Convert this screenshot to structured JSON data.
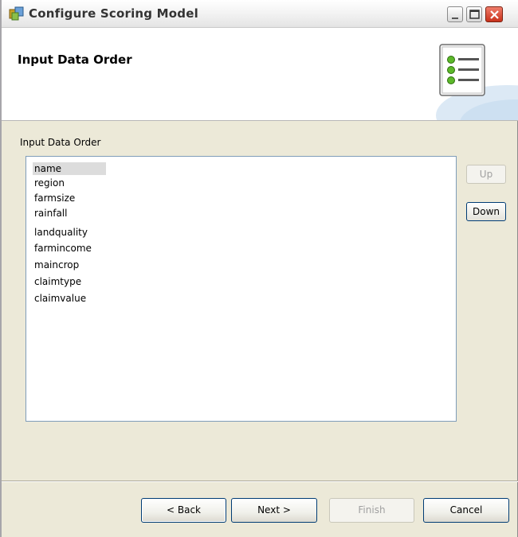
{
  "window": {
    "title": "Configure Scoring Model"
  },
  "banner": {
    "title": "Input Data Order",
    "icon": "list-icon"
  },
  "main": {
    "section_label": "Input Data Order",
    "fields": [
      "name",
      "region",
      "farmsize",
      "rainfall",
      "landquality",
      "farmincome",
      "maincrop",
      "claimtype",
      "claimvalue"
    ],
    "selected_field": "name",
    "up_label": "Up",
    "down_label": "Down"
  },
  "footer": {
    "back_label": "< Back",
    "next_label": "Next >",
    "finish_label": "Finish",
    "cancel_label": "Cancel"
  },
  "colors": {
    "accent_green": "#3a9a1a",
    "close_red": "#c8311b"
  }
}
